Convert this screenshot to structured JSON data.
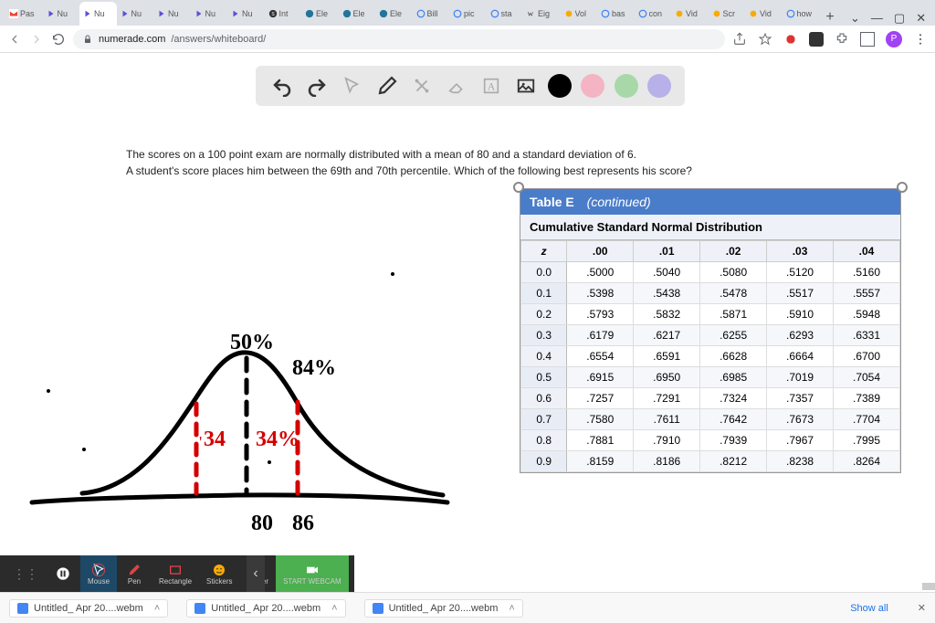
{
  "browser": {
    "tabs": [
      {
        "label": "Pas",
        "kind": "gmail"
      },
      {
        "label": "Nu",
        "kind": "numerade"
      },
      {
        "label": "Nu",
        "kind": "numerade",
        "active": true
      },
      {
        "label": "Nu",
        "kind": "numerade"
      },
      {
        "label": "Nu",
        "kind": "numerade"
      },
      {
        "label": "Nu",
        "kind": "numerade"
      },
      {
        "label": "Nu",
        "kind": "numerade"
      },
      {
        "label": "Int",
        "kind": "skype"
      },
      {
        "label": "Ele",
        "kind": "wp"
      },
      {
        "label": "Ele",
        "kind": "wp"
      },
      {
        "label": "Ele",
        "kind": "wp"
      },
      {
        "label": "Bill",
        "kind": "google"
      },
      {
        "label": "pic",
        "kind": "google"
      },
      {
        "label": "sta",
        "kind": "google"
      },
      {
        "label": "Eig",
        "kind": "wiki"
      },
      {
        "label": "Vol",
        "kind": "vol"
      },
      {
        "label": "bas",
        "kind": "google"
      },
      {
        "label": "con",
        "kind": "google"
      },
      {
        "label": "Vid",
        "kind": "vid"
      },
      {
        "label": "Scr",
        "kind": "scr"
      },
      {
        "label": "Vid",
        "kind": "vid"
      },
      {
        "label": "how",
        "kind": "google"
      }
    ],
    "url_host": "numerade.com",
    "url_path": "/answers/whiteboard/",
    "avatar_letter": "P"
  },
  "question": {
    "line1": "The scores on a 100 point exam are normally distributed with a mean of 80 and a standard deviation of 6.",
    "line2": "A student's score places him between the 69th and 70th percentile. Which of the following best represents his score?"
  },
  "drawing": {
    "label_50": "50%",
    "label_84": "84%",
    "label_34l": "34",
    "label_34r": "34%",
    "x_80": "80",
    "x_86": "86"
  },
  "table": {
    "title": "Table E",
    "continued": "(continued)",
    "subtitle": "Cumulative Standard Normal Distribution",
    "headers": [
      "z",
      ".00",
      ".01",
      ".02",
      ".03",
      ".04"
    ],
    "rows": [
      [
        "0.0",
        ".5000",
        ".5040",
        ".5080",
        ".5120",
        ".5160"
      ],
      [
        "0.1",
        ".5398",
        ".5438",
        ".5478",
        ".5517",
        ".5557"
      ],
      [
        "0.2",
        ".5793",
        ".5832",
        ".5871",
        ".5910",
        ".5948"
      ],
      [
        "0.3",
        ".6179",
        ".6217",
        ".6255",
        ".6293",
        ".6331"
      ],
      [
        "0.4",
        ".6554",
        ".6591",
        ".6628",
        ".6664",
        ".6700"
      ],
      [
        "0.5",
        ".6915",
        ".6950",
        ".6985",
        ".7019",
        ".7054"
      ],
      [
        "0.6",
        ".7257",
        ".7291",
        ".7324",
        ".7357",
        ".7389"
      ],
      [
        "0.7",
        ".7580",
        ".7611",
        ".7642",
        ".7673",
        ".7704"
      ],
      [
        "0.8",
        ".7881",
        ".7910",
        ".7939",
        ".7967",
        ".7995"
      ],
      [
        "0.9",
        ".8159",
        ".8186",
        ".8212",
        ".8238",
        ".8264"
      ]
    ]
  },
  "app_toolbar": {
    "colors": {
      "black": "#000000",
      "pink": "#f4b4c4",
      "green": "#a8d8a8",
      "purple": "#b8b0e8"
    },
    "items": [
      "undo",
      "redo",
      "pointer",
      "pen",
      "tools",
      "eraser",
      "text",
      "image"
    ]
  },
  "bottom_bar": {
    "items": [
      {
        "label": "",
        "kind": "pause"
      },
      {
        "label": "Mouse",
        "kind": "mouse",
        "active": true
      },
      {
        "label": "Pen",
        "kind": "pen"
      },
      {
        "label": "Rectangle",
        "kind": "rect"
      },
      {
        "label": "Stickers",
        "kind": "stickers"
      },
      {
        "label": "Eraser",
        "kind": "eraser"
      },
      {
        "label": "START WEBCAM",
        "kind": "webcam"
      }
    ]
  },
  "downloads": {
    "items": [
      "Untitled_ Apr 20....webm",
      "Untitled_ Apr 20....webm",
      "Untitled_ Apr 20....webm"
    ],
    "show_all": "Show all"
  }
}
